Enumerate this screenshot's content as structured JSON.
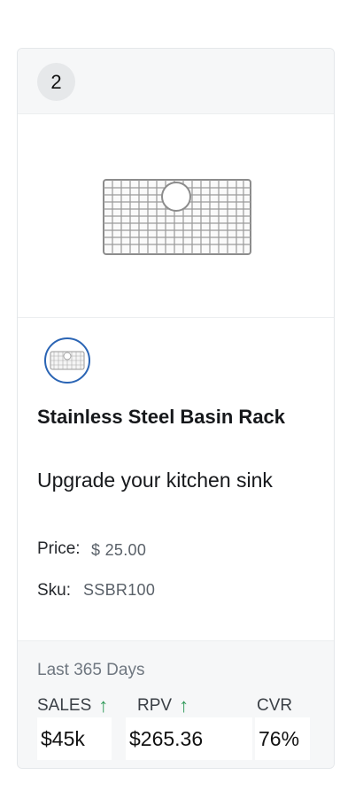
{
  "card": {
    "rank": "2",
    "product": {
      "title": "Stainless Steel Basin Rack",
      "subtitle": "Upgrade your kitchen sink",
      "image_icon": "basin-rack-image",
      "swatch_icon": "basin-rack-thumbnail"
    },
    "details": {
      "price_label": "Price:",
      "price_value": "$ 25.00",
      "sku_label": "Sku:",
      "sku_value": "SSBR100"
    },
    "stats": {
      "period": "Last 365 Days",
      "metrics": [
        {
          "label": "SALES",
          "value": "$45k",
          "trend": "up",
          "trend_icon": "↑"
        },
        {
          "label": "RPV",
          "value": "$265.36",
          "trend": "up",
          "trend_icon": "↑"
        },
        {
          "label": "CVR",
          "value": "76%"
        }
      ]
    },
    "colors": {
      "accent_border": "#2a64b4",
      "trend_up": "#2f9a59",
      "header_bg": "#f6f7f8"
    }
  }
}
